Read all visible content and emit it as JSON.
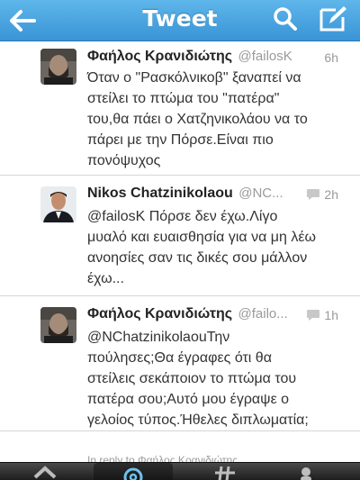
{
  "navbar": {
    "title": "Tweet",
    "back_icon": "back-arrow-icon",
    "search_icon": "search-icon",
    "compose_icon": "compose-icon",
    "bar_color": "#4aa6e2"
  },
  "tweets": [
    {
      "name": "Φαήλος Κρανιδιώτης",
      "handle": "@failosK",
      "time": "6h",
      "lines": [
        "Όταν ο \"Ρασκόλνικοβ\" ξαναπεί να",
        "στείλει το πτώμα του \"πατέρα\"",
        "του,θα πάει ο Χατζηνικολάου να το",
        "πάρει με την Πόρσε.Είναι πιο",
        "πονόψυχος"
      ]
    },
    {
      "name": "Nikos Chatzinikolaou",
      "handle": "@NC...",
      "time": "2h",
      "lines": [
        "@failosK Πόρσε δεν έχω.Λίγο",
        "μυαλό και ευαισθησία για να μη λέω",
        "ανοησίες σαν τις δικές σου μάλλον",
        "έχω..."
      ]
    },
    {
      "name": "Φαήλος Κρανιδιώτης",
      "handle": "@failo...",
      "time": "1h",
      "lines": [
        "@NChatzinikolaouΤην",
        "πούλησες;Θα έγραφες ότι θα",
        "στείλεις σεκάποιον το πτώμα του",
        "πατέρα σου;Αυτό μου έγραψε ο",
        "γελοίος τύπος.Ήθελες διπλωματία;"
      ]
    }
  ],
  "in_reply_to": "In reply to Φαήλος Κρανιδιώτης",
  "tabbar": {
    "tabs": [
      "home-icon",
      "connect-icon",
      "discover-icon",
      "me-icon"
    ],
    "selected": "connect-icon"
  }
}
